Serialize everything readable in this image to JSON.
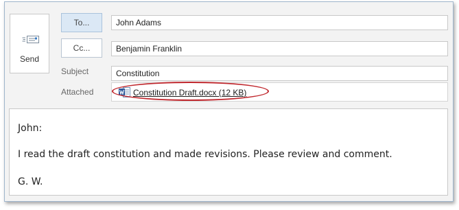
{
  "compose": {
    "send_label": "Send",
    "to_button": "To...",
    "cc_button": "Cc...",
    "to_value": "John Adams",
    "cc_value": "Benjamin Franklin",
    "subject_label": "Subject",
    "subject_value": "Constitution",
    "attached_label": "Attached",
    "attachment": {
      "name": "Constitution Draft.docx (12 KB)",
      "icon": "word-document-icon"
    },
    "body": {
      "greeting": "John:",
      "message": "I read the draft constitution and made revisions. Please review and comment.",
      "signature": "G. W."
    }
  },
  "colors": {
    "to_button_bg": "#dbe8f5",
    "highlight_oval": "#c0272d",
    "word_blue": "#2b579a"
  }
}
